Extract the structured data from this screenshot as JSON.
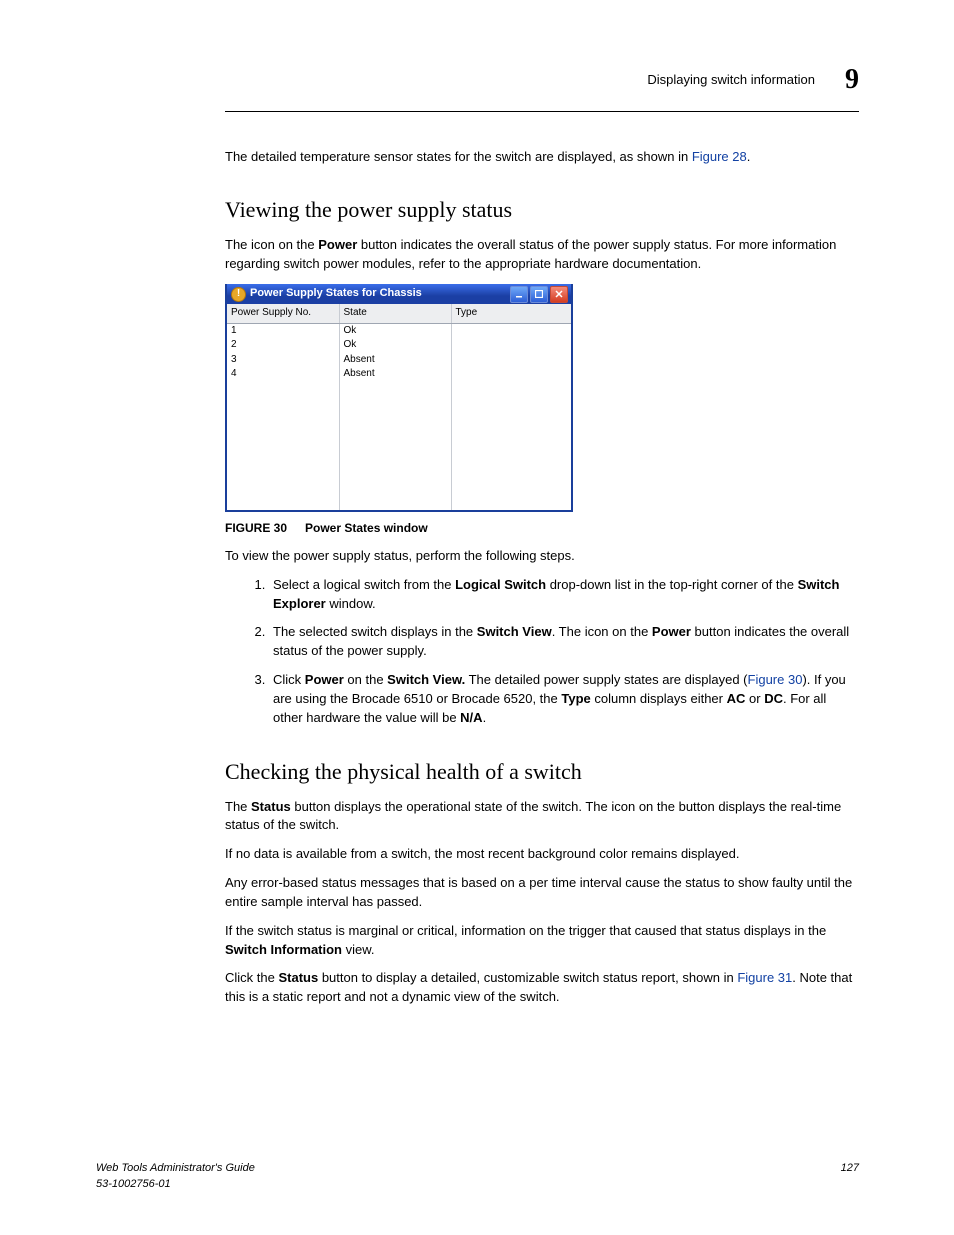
{
  "header": {
    "section": "Displaying switch information",
    "chapter": "9"
  },
  "intro_para": {
    "text": "The detailed temperature sensor states for the switch are displayed, as shown in ",
    "link": "Figure 28",
    "after": "."
  },
  "h_power": "Viewing the power supply status",
  "power_para1": {
    "a": "The icon on the ",
    "b1": "Power",
    "b": " button indicates the overall status of the power supply status. For more information regarding switch power modules, refer to the appropriate hardware documentation."
  },
  "dialog": {
    "title": "Power Supply States for Chassis",
    "cols": [
      "Power Supply No.",
      "State",
      "Type"
    ],
    "rows": [
      {
        "no": "1",
        "state": "Ok",
        "type": ""
      },
      {
        "no": "2",
        "state": "Ok",
        "type": ""
      },
      {
        "no": "3",
        "state": "Absent",
        "type": ""
      },
      {
        "no": "4",
        "state": "Absent",
        "type": ""
      }
    ]
  },
  "figure30": {
    "label": "FIGURE 30",
    "caption": "Power States window"
  },
  "power_para2": "To view the power supply status, perform the following steps.",
  "steps": {
    "s1": {
      "a": "Select a logical switch from the ",
      "b1": "Logical Switch",
      "b": " drop-down list in the top-right corner of the ",
      "b2": "Switch Explorer",
      "c": " window."
    },
    "s2": {
      "a": "The selected switch displays in the ",
      "b1": "Switch View",
      "b": ". The icon on the ",
      "b2": "Power",
      "c": " button indicates the overall status of the power supply."
    },
    "s3": {
      "a": "Click ",
      "b1": "Power",
      "b": " on the ",
      "b2": "Switch View.",
      "c": " The detailed power supply states are displayed (",
      "link": "Figure 30",
      "d": "). If you are using the Brocade 6510 or Brocade 6520, the ",
      "b3": "Type",
      "e": " column displays either ",
      "b4": "AC",
      "f": " or ",
      "b5": "DC",
      "g": ". For all other hardware the value will be ",
      "b6": "N/A",
      "h": "."
    }
  },
  "h_health": "Checking the physical health of a switch",
  "health": {
    "p1": {
      "a": "The ",
      "b1": "Status",
      "b": " button displays the operational state of the switch. The icon on the button displays the real-time status of the switch."
    },
    "p2": "If no data is available from a switch, the most recent background color remains displayed.",
    "p3": "Any error-based status messages that is based on a per time interval cause the status to show faulty until the entire sample interval has passed.",
    "p4": {
      "a": "If the switch status is marginal or critical, information on the trigger that caused that status displays in the ",
      "b1": "Switch Information",
      "b": " view."
    },
    "p5": {
      "a": "Click the ",
      "b1": "Status",
      "b": " button to display a detailed, customizable switch status report, shown in ",
      "link": "Figure 31",
      "c": ". Note that this is a static report and not a dynamic view of the switch."
    }
  },
  "footer": {
    "title": "Web Tools Administrator's Guide",
    "docnum": "53-1002756-01",
    "page": "127"
  }
}
